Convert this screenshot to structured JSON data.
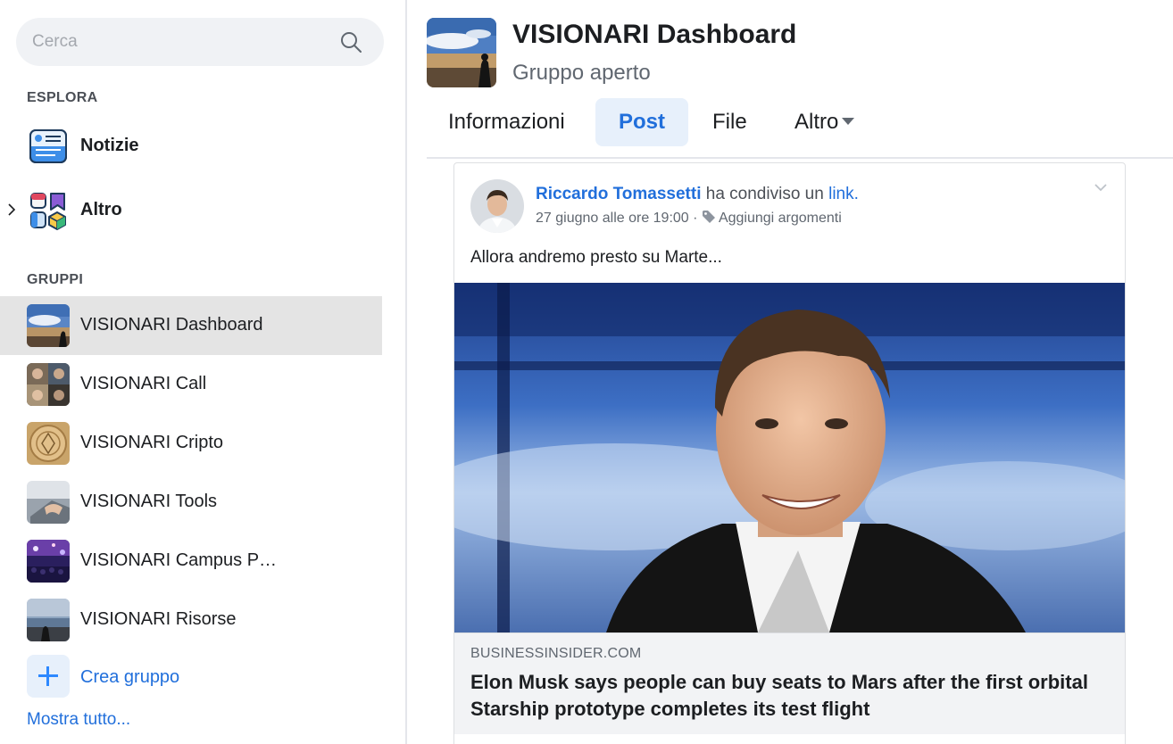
{
  "sidebar": {
    "search": {
      "placeholder": "Cerca"
    },
    "explore": {
      "title": "ESPLORA",
      "items": [
        {
          "label": "Notizie",
          "icon": "news-feed-icon"
        },
        {
          "label": "Altro",
          "icon": "more-apps-icon"
        }
      ]
    },
    "groups": {
      "title": "GRUPPI",
      "items": [
        {
          "label": "VISIONARI Dashboard",
          "active": true
        },
        {
          "label": "VISIONARI Call"
        },
        {
          "label": "VISIONARI Cripto"
        },
        {
          "label": "VISIONARI Tools"
        },
        {
          "label": "VISIONARI Campus P…"
        },
        {
          "label": "VISIONARI Risorse"
        }
      ]
    },
    "create_group": "Crea gruppo",
    "show_all": "Mostra tutto..."
  },
  "main": {
    "group_name": "VISIONARI Dashboard",
    "group_type": "Gruppo aperto",
    "tabs": [
      {
        "label": "Informazioni"
      },
      {
        "label": "Post",
        "active": true
      },
      {
        "label": "File"
      },
      {
        "label": "Altro"
      }
    ],
    "post": {
      "author": "Riccardo Tomassetti",
      "action": "ha condiviso un",
      "object": "link.",
      "date": "27 giugno alle ore 19:00",
      "separator": "·",
      "add_topics": "Aggiungi argomenti",
      "text": "Allora andremo presto su Marte...",
      "link": {
        "domain": "BUSINESSINSIDER.COM",
        "headline": "Elon Musk says people can buy seats to Mars after the first orbital Starship prototype completes its test flight"
      }
    }
  },
  "colors": {
    "accent": "#216fdb",
    "active_tab_bg": "#e7f0fb",
    "active_group_bg": "#e4e4e4"
  }
}
